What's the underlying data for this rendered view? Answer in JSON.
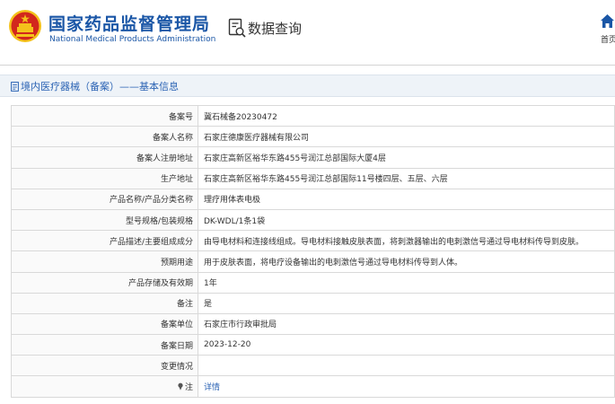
{
  "header": {
    "brand_cn": "国家药品监督管理局",
    "brand_en": "National Medical Products Administration",
    "query_title": "数据查询",
    "home_label": "首页",
    "colors": {
      "brand": "#1a56a6",
      "emblem_red": "#d2271d",
      "emblem_gold": "#f4c21b"
    }
  },
  "breadcrumb": {
    "text": "境内医疗器械（备案）——基本信息"
  },
  "details": {
    "rows": [
      {
        "label": "备案号",
        "value": "冀石械备20230472"
      },
      {
        "label": "备案人名称",
        "value": "石家庄德康医疗器械有限公司"
      },
      {
        "label": "备案人注册地址",
        "value": "石家庄高新区裕华东路455号润江总部国际大厦4层"
      },
      {
        "label": "生产地址",
        "value": "石家庄高新区裕华东路455号润江总部国际11号楼四层、五层、六层"
      },
      {
        "label": "产品名称/产品分类名称",
        "value": "理疗用体表电极"
      },
      {
        "label": "型号规格/包装规格",
        "value": "DK-WDL/1条1袋"
      },
      {
        "label": "产品描述/主要组成成分",
        "value": "由导电材料和连接线组成。导电材料接触皮肤表面，将刺激器输出的电刺激信号通过导电材料传导到皮肤。"
      },
      {
        "label": "预期用途",
        "value": "用于皮肤表面，将电疗设备输出的电刺激信号通过导电材料传导到人体。"
      },
      {
        "label": "产品存储及有效期",
        "value": "1年"
      },
      {
        "label": "备注",
        "value": "是"
      },
      {
        "label": "备案单位",
        "value": "石家庄市行政审批局"
      },
      {
        "label": "备案日期",
        "value": "2023-12-20"
      },
      {
        "label": "变更情况",
        "value": ""
      },
      {
        "label": "注",
        "value": "详情"
      }
    ],
    "colors": {
      "link": "#2b63b4",
      "border": "#d9d9d9"
    }
  }
}
